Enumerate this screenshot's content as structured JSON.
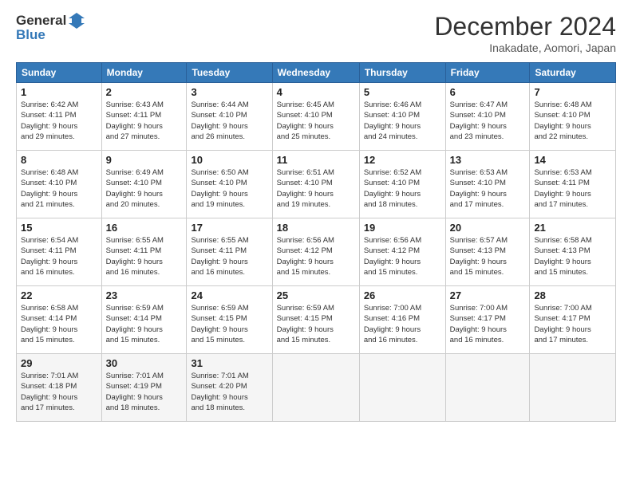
{
  "header": {
    "logo_line1": "General",
    "logo_line2": "Blue",
    "month": "December 2024",
    "location": "Inakadate, Aomori, Japan"
  },
  "weekdays": [
    "Sunday",
    "Monday",
    "Tuesday",
    "Wednesday",
    "Thursday",
    "Friday",
    "Saturday"
  ],
  "weeks": [
    [
      {
        "day": "1",
        "info": "Sunrise: 6:42 AM\nSunset: 4:11 PM\nDaylight: 9 hours\nand 29 minutes."
      },
      {
        "day": "2",
        "info": "Sunrise: 6:43 AM\nSunset: 4:11 PM\nDaylight: 9 hours\nand 27 minutes."
      },
      {
        "day": "3",
        "info": "Sunrise: 6:44 AM\nSunset: 4:10 PM\nDaylight: 9 hours\nand 26 minutes."
      },
      {
        "day": "4",
        "info": "Sunrise: 6:45 AM\nSunset: 4:10 PM\nDaylight: 9 hours\nand 25 minutes."
      },
      {
        "day": "5",
        "info": "Sunrise: 6:46 AM\nSunset: 4:10 PM\nDaylight: 9 hours\nand 24 minutes."
      },
      {
        "day": "6",
        "info": "Sunrise: 6:47 AM\nSunset: 4:10 PM\nDaylight: 9 hours\nand 23 minutes."
      },
      {
        "day": "7",
        "info": "Sunrise: 6:48 AM\nSunset: 4:10 PM\nDaylight: 9 hours\nand 22 minutes."
      }
    ],
    [
      {
        "day": "8",
        "info": "Sunrise: 6:48 AM\nSunset: 4:10 PM\nDaylight: 9 hours\nand 21 minutes."
      },
      {
        "day": "9",
        "info": "Sunrise: 6:49 AM\nSunset: 4:10 PM\nDaylight: 9 hours\nand 20 minutes."
      },
      {
        "day": "10",
        "info": "Sunrise: 6:50 AM\nSunset: 4:10 PM\nDaylight: 9 hours\nand 19 minutes."
      },
      {
        "day": "11",
        "info": "Sunrise: 6:51 AM\nSunset: 4:10 PM\nDaylight: 9 hours\nand 19 minutes."
      },
      {
        "day": "12",
        "info": "Sunrise: 6:52 AM\nSunset: 4:10 PM\nDaylight: 9 hours\nand 18 minutes."
      },
      {
        "day": "13",
        "info": "Sunrise: 6:53 AM\nSunset: 4:10 PM\nDaylight: 9 hours\nand 17 minutes."
      },
      {
        "day": "14",
        "info": "Sunrise: 6:53 AM\nSunset: 4:11 PM\nDaylight: 9 hours\nand 17 minutes."
      }
    ],
    [
      {
        "day": "15",
        "info": "Sunrise: 6:54 AM\nSunset: 4:11 PM\nDaylight: 9 hours\nand 16 minutes."
      },
      {
        "day": "16",
        "info": "Sunrise: 6:55 AM\nSunset: 4:11 PM\nDaylight: 9 hours\nand 16 minutes."
      },
      {
        "day": "17",
        "info": "Sunrise: 6:55 AM\nSunset: 4:11 PM\nDaylight: 9 hours\nand 16 minutes."
      },
      {
        "day": "18",
        "info": "Sunrise: 6:56 AM\nSunset: 4:12 PM\nDaylight: 9 hours\nand 15 minutes."
      },
      {
        "day": "19",
        "info": "Sunrise: 6:56 AM\nSunset: 4:12 PM\nDaylight: 9 hours\nand 15 minutes."
      },
      {
        "day": "20",
        "info": "Sunrise: 6:57 AM\nSunset: 4:13 PM\nDaylight: 9 hours\nand 15 minutes."
      },
      {
        "day": "21",
        "info": "Sunrise: 6:58 AM\nSunset: 4:13 PM\nDaylight: 9 hours\nand 15 minutes."
      }
    ],
    [
      {
        "day": "22",
        "info": "Sunrise: 6:58 AM\nSunset: 4:14 PM\nDaylight: 9 hours\nand 15 minutes."
      },
      {
        "day": "23",
        "info": "Sunrise: 6:59 AM\nSunset: 4:14 PM\nDaylight: 9 hours\nand 15 minutes."
      },
      {
        "day": "24",
        "info": "Sunrise: 6:59 AM\nSunset: 4:15 PM\nDaylight: 9 hours\nand 15 minutes."
      },
      {
        "day": "25",
        "info": "Sunrise: 6:59 AM\nSunset: 4:15 PM\nDaylight: 9 hours\nand 15 minutes."
      },
      {
        "day": "26",
        "info": "Sunrise: 7:00 AM\nSunset: 4:16 PM\nDaylight: 9 hours\nand 16 minutes."
      },
      {
        "day": "27",
        "info": "Sunrise: 7:00 AM\nSunset: 4:17 PM\nDaylight: 9 hours\nand 16 minutes."
      },
      {
        "day": "28",
        "info": "Sunrise: 7:00 AM\nSunset: 4:17 PM\nDaylight: 9 hours\nand 17 minutes."
      }
    ],
    [
      {
        "day": "29",
        "info": "Sunrise: 7:01 AM\nSunset: 4:18 PM\nDaylight: 9 hours\nand 17 minutes."
      },
      {
        "day": "30",
        "info": "Sunrise: 7:01 AM\nSunset: 4:19 PM\nDaylight: 9 hours\nand 18 minutes."
      },
      {
        "day": "31",
        "info": "Sunrise: 7:01 AM\nSunset: 4:20 PM\nDaylight: 9 hours\nand 18 minutes."
      },
      null,
      null,
      null,
      null
    ]
  ]
}
